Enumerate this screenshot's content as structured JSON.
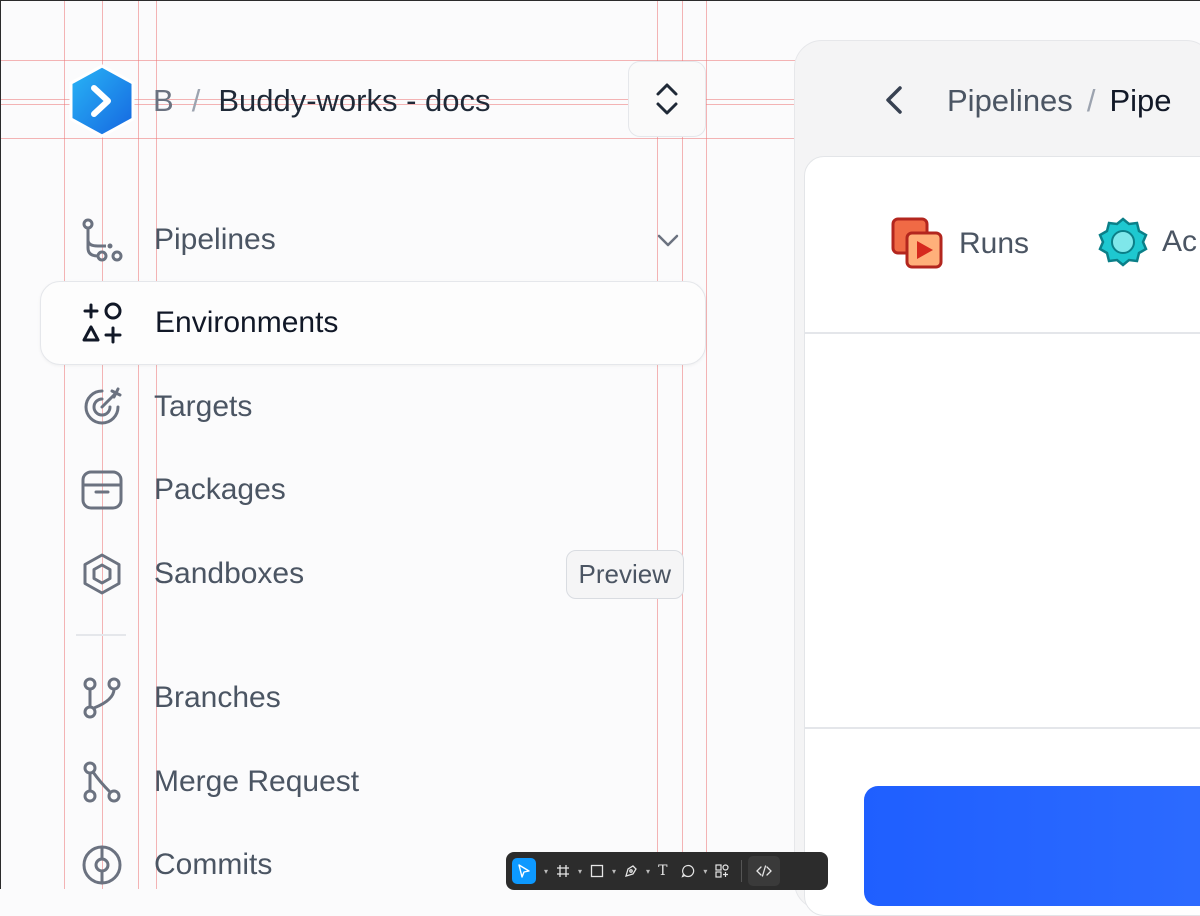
{
  "header": {
    "workspace_letter": "B",
    "separator": "/",
    "project_name": "Buddy-works - docs"
  },
  "nav": {
    "items": [
      {
        "label": "Pipelines",
        "icon": "pipelines-icon"
      },
      {
        "label": "Environments",
        "icon": "environments-icon"
      },
      {
        "label": "Targets",
        "icon": "target-icon"
      },
      {
        "label": "Packages",
        "icon": "package-icon"
      },
      {
        "label": "Sandboxes",
        "icon": "sandbox-icon",
        "badge": "Preview"
      },
      {
        "label": "Branches",
        "icon": "branch-icon"
      },
      {
        "label": "Merge Request",
        "icon": "merge-request-icon"
      },
      {
        "label": "Commits",
        "icon": "commit-icon"
      }
    ]
  },
  "panel": {
    "breadcrumb_parent": "Pipelines",
    "breadcrumb_sep": "/",
    "breadcrumb_current": "Pipe",
    "tabs": [
      {
        "label": "Runs",
        "icon": "runs-icon"
      },
      {
        "label": "Ac",
        "icon": "actions-icon"
      }
    ]
  },
  "toolbar": {
    "tools": [
      "move-tool-icon",
      "frame-tool-icon",
      "rectangle-tool-icon",
      "pen-tool-icon",
      "text-tool-icon",
      "comment-tool-icon",
      "components-tool-icon",
      "code-tool-icon"
    ],
    "text_glyph": "T"
  },
  "colors": {
    "accent": "#0d99ff",
    "guides": "#ec7878",
    "logo_blue": "#1a8cf0",
    "runs_red": "#e8452e",
    "actions_teal": "#1ec8d0",
    "cta_blue": "#1f5fff"
  }
}
